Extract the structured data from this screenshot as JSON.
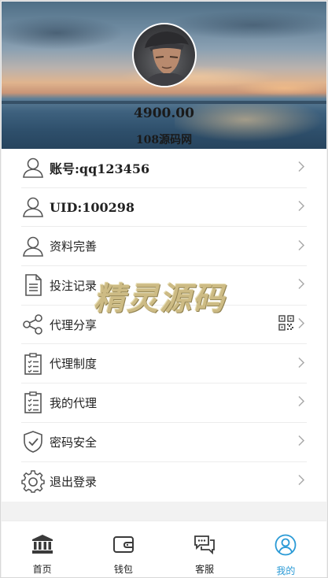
{
  "header": {
    "balance": "4900.00",
    "site_name": "108源码网"
  },
  "menu": {
    "items": [
      {
        "label": "账号:qq123456",
        "icon": "user-icon"
      },
      {
        "label": "UID:100298",
        "icon": "user-icon"
      },
      {
        "label": "资料完善",
        "icon": "user-icon"
      },
      {
        "label": "投注记录",
        "icon": "document-icon"
      },
      {
        "label": "代理分享",
        "icon": "share-icon"
      },
      {
        "label": "代理制度",
        "icon": "clipboard-list-icon"
      },
      {
        "label": "我的代理",
        "icon": "clipboard-list-icon"
      },
      {
        "label": "密码安全",
        "icon": "shield-check-icon"
      },
      {
        "label": "退出登录",
        "icon": "gear-icon"
      }
    ]
  },
  "watermark": "精灵源码",
  "tabbar": {
    "tabs": [
      {
        "label": "首页",
        "icon": "bank-icon",
        "active": false
      },
      {
        "label": "钱包",
        "icon": "wallet-icon",
        "active": false
      },
      {
        "label": "客服",
        "icon": "chat-icon",
        "active": false
      },
      {
        "label": "我的",
        "icon": "user-circle-icon",
        "active": true
      }
    ]
  },
  "colors": {
    "accent": "#2a9ad6",
    "icon": "#555555",
    "text": "#222222"
  }
}
